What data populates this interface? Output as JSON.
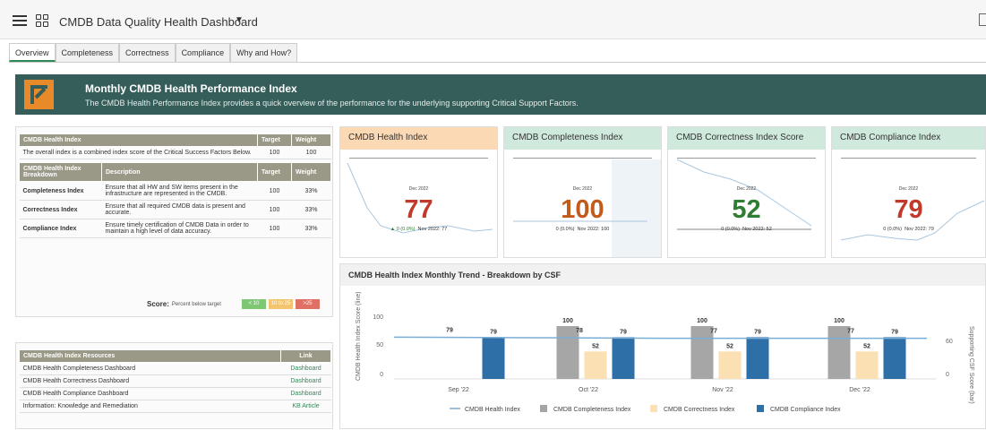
{
  "app": {
    "title": "CMDB Data Quality Health Dashboard"
  },
  "tabs": [
    "Overview",
    "Completeness",
    "Correctness",
    "Compliance",
    "Why and How?"
  ],
  "banner": {
    "title": "Monthly CMDB Health Performance Index",
    "subtitle": "The CMDB Health Performance Index provides a quick overview of the performance for the underlying supporting Critical Support Factors."
  },
  "index_table": {
    "headers": [
      "CMDB Health Index",
      "Target",
      "Weight"
    ],
    "overall": {
      "text": "The overall index is a combined index score of the Critical Success Factors Below.",
      "target": "100",
      "weight": "100"
    },
    "breakdown_headers": [
      "CMDB Health Index Breakdown",
      "Description",
      "Target",
      "Weight"
    ],
    "rows": [
      {
        "name": "Completeness Index",
        "desc": "Ensure that all HW and SW items present in the infrastructure are represented in the CMDB.",
        "target": "100",
        "weight": "33%"
      },
      {
        "name": "Correctness Index",
        "desc": "Ensure that all required CMDB data is present and accurate.",
        "target": "100",
        "weight": "33%"
      },
      {
        "name": "Compliance Index",
        "desc": "Ensure timely certification of CMDB Data in order to maintain a high level of data accuracy.",
        "target": "100",
        "weight": "33%"
      }
    ],
    "score": {
      "label": "Score:",
      "sub": "Percent below target",
      "green": "< 10",
      "yellow": "10 to 25",
      "red": ">25",
      "colors": {
        "green": "#7ec874",
        "yellow": "#f3c56f",
        "red": "#e07063"
      }
    }
  },
  "resources": {
    "headers": [
      "CMDB Health Index Resources",
      "Link"
    ],
    "rows": [
      {
        "name": "CMDB Health Completeness Dashboard",
        "link": "Dashboard"
      },
      {
        "name": "CMDB Health Correctness Dashboard",
        "link": "Dashboard"
      },
      {
        "name": "CMDB Health Compliance Dashboard",
        "link": "Dashboard"
      },
      {
        "name": "Information:  Knowledge and Remediation",
        "link": "KB Article"
      }
    ]
  },
  "cards": [
    {
      "title": "CMDB Health Index",
      "period": "Dec 2022",
      "value": "77",
      "change": "▲ 0 (0.0%)",
      "prev": "Nov 2022: 77",
      "header_color": "#fbd9b5",
      "value_color": "#c0392b"
    },
    {
      "title": "CMDB Completeness Index",
      "period": "Dec 2022",
      "value": "100",
      "change": "0 (0.0%)",
      "prev": "Nov 2022: 100",
      "header_color": "#cfe9dd",
      "value_color": "#c25a1a"
    },
    {
      "title": "CMDB Correctness Index Score",
      "period": "Dec 2022",
      "value": "52",
      "change": "0 (0.0%)",
      "prev": "Nov 2022: 52",
      "header_color": "#cfe9dd",
      "value_color": "#2e7d32"
    },
    {
      "title": "CMDB Compliance Index",
      "period": "Dec 2022",
      "value": "79",
      "change": "0 (0.0%)",
      "prev": "Nov 2022: 79",
      "header_color": "#cfe9dd",
      "value_color": "#c0392b"
    }
  ],
  "chart_data": {
    "type": "bar",
    "title": "CMDB Health Index Monthly Trend - Breakdown by CSF",
    "categories": [
      "Sep '22",
      "Oct '22",
      "Nov '22",
      "Dec '22"
    ],
    "ylabel": "CMDB Health Index Score (line)",
    "y2label": "Supporting CSF Score (bar)",
    "ylim": [
      0,
      100
    ],
    "y_ticks": [
      "100",
      "50",
      "0"
    ],
    "y2_ticks": [
      "60",
      "0"
    ],
    "series": [
      {
        "name": "CMDB Health Index",
        "kind": "line",
        "color": "#7aaed6",
        "values": [
          79,
          78,
          77,
          77
        ]
      },
      {
        "name": "CMDB Completeness Index",
        "kind": "bar",
        "color": "#a6a6a6",
        "values": [
          null,
          100,
          100,
          100
        ]
      },
      {
        "name": "CMDB Correctness Index",
        "kind": "bar",
        "color": "#fbe0b3",
        "values": [
          null,
          52,
          52,
          52
        ]
      },
      {
        "name": "CMDB Compliance Index",
        "kind": "bar",
        "color": "#2e6fa7",
        "values": [
          79,
          79,
          79,
          79
        ]
      }
    ]
  }
}
